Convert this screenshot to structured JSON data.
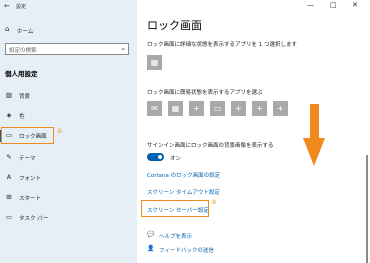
{
  "window": {
    "title": "設定",
    "back": "←",
    "minimize": "—",
    "maximize": "□",
    "close": "✕"
  },
  "sidebar": {
    "home": "ホーム",
    "search_placeholder": "設定の検索",
    "section": "個人用設定",
    "items": [
      {
        "label": "背景",
        "icon": "image-icon",
        "glyph": "▨"
      },
      {
        "label": "色",
        "icon": "palette-icon",
        "glyph": "◈"
      },
      {
        "label": "ロック画面",
        "icon": "lock-screen-icon",
        "glyph": "▭"
      },
      {
        "label": "テーマ",
        "icon": "theme-icon",
        "glyph": "✎"
      },
      {
        "label": "フォント",
        "icon": "font-icon",
        "glyph": "A"
      },
      {
        "label": "スタート",
        "icon": "start-icon",
        "glyph": "⊞"
      },
      {
        "label": "タスク バー",
        "icon": "taskbar-icon",
        "glyph": "▭"
      }
    ],
    "active_index": 2
  },
  "annotations": {
    "num1": "①",
    "num2": "②"
  },
  "main": {
    "title": "ロック画面",
    "detailed_app_desc": "ロック画面に詳細な状態を表示するアプリを 1 つ選択します",
    "quick_status_desc": "ロック画面に簡易状態を表示するアプリを選ぶ",
    "bg_desc": "サインイン画面にロック画面の背景画像を表示する",
    "toggle_label": "オン",
    "links": {
      "cortana": "Cortana のロック画面の設定",
      "timeout": "スクリーン タイムアウト設定",
      "screensaver": "スクリーン セーバー設定"
    },
    "help": "ヘルプを表示",
    "feedback": "フィードバックの送信"
  },
  "colors": {
    "accent": "#0063b1",
    "highlight": "#f08a1c",
    "sidebar_bg": "#e6eef6",
    "tile": "#a9a9a9"
  }
}
